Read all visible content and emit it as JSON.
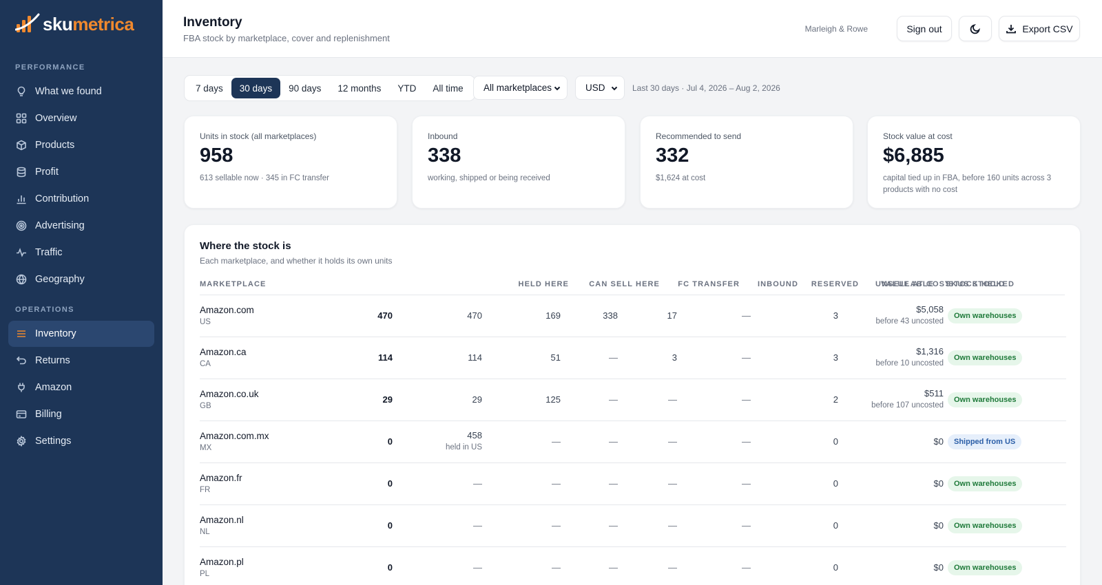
{
  "brand": {
    "part1": "sku",
    "part2": "metrica"
  },
  "sidebar": {
    "section_performance": "PERFORMANCE",
    "section_operations": "OPERATIONS",
    "items": [
      {
        "label": "What we found",
        "icon": "lightbulb-icon"
      },
      {
        "label": "Overview",
        "icon": "grid-icon"
      },
      {
        "label": "Products",
        "icon": "box-icon"
      },
      {
        "label": "Profit",
        "icon": "database-icon"
      },
      {
        "label": "Contribution",
        "icon": "bar-chart-icon"
      },
      {
        "label": "Advertising",
        "icon": "target-icon"
      },
      {
        "label": "Traffic",
        "icon": "activity-icon"
      },
      {
        "label": "Geography",
        "icon": "globe-icon"
      },
      {
        "label": "Inventory",
        "icon": "list-icon",
        "active": true
      },
      {
        "label": "Returns",
        "icon": "return-icon"
      },
      {
        "label": "Amazon",
        "icon": "plug-icon"
      },
      {
        "label": "Billing",
        "icon": "card-icon"
      },
      {
        "label": "Settings",
        "icon": "gear-icon"
      }
    ]
  },
  "header": {
    "title": "Inventory",
    "subtitle": "FBA stock by marketplace, cover and replenishment",
    "account": "Marleigh & Rowe",
    "signout": "Sign out",
    "export": "Export CSV"
  },
  "filters": {
    "ranges": [
      "7 days",
      "30 days",
      "90 days",
      "12 months",
      "YTD",
      "All time"
    ],
    "active_range": "30 days",
    "marketplace": "All marketplaces",
    "currency": "USD",
    "range_note": "Last 30 days · Jul 4, 2026 – Aug 2, 2026"
  },
  "kpis": [
    {
      "label": "Units in stock (all marketplaces)",
      "value": "958",
      "note": "613 sellable now · 345 in FC transfer"
    },
    {
      "label": "Inbound",
      "value": "338",
      "note": "working, shipped or being received"
    },
    {
      "label": "Recommended to send",
      "value": "332",
      "note": "$1,624 at cost"
    },
    {
      "label": "Stock value at cost",
      "value": "$6,885",
      "note": "capital tied up in FBA, before 160 units across 3 products with no cost"
    }
  ],
  "table": {
    "title": "Where the stock is",
    "subtitle": "Each marketplace, and whether it holds its own units",
    "columns": [
      "MARKETPLACE",
      "HELD HERE",
      "CAN SELL HERE",
      "FC TRANSFER",
      "INBOUND",
      "RESERVED",
      "UNSELLABLE",
      "SKUS STOCKED",
      "VALUE AT COST",
      "STOCK HELD"
    ],
    "rows": [
      {
        "name": "Amazon.com",
        "code": "US",
        "held": "470",
        "can_sell": "470",
        "can_sell_note": "",
        "fc": "169",
        "inbound": "338",
        "reserved": "17",
        "unsellable": "—",
        "skus": "3",
        "value": "$5,058",
        "value_note": "before 43 uncosted",
        "stock_held": "Own warehouses",
        "badge": "green"
      },
      {
        "name": "Amazon.ca",
        "code": "CA",
        "held": "114",
        "can_sell": "114",
        "can_sell_note": "",
        "fc": "51",
        "inbound": "—",
        "reserved": "3",
        "unsellable": "—",
        "skus": "3",
        "value": "$1,316",
        "value_note": "before 10 uncosted",
        "stock_held": "Own warehouses",
        "badge": "green"
      },
      {
        "name": "Amazon.co.uk",
        "code": "GB",
        "held": "29",
        "can_sell": "29",
        "can_sell_note": "",
        "fc": "125",
        "inbound": "—",
        "reserved": "—",
        "unsellable": "—",
        "skus": "2",
        "value": "$511",
        "value_note": "before 107 uncosted",
        "stock_held": "Own warehouses",
        "badge": "green"
      },
      {
        "name": "Amazon.com.mx",
        "code": "MX",
        "held": "0",
        "can_sell": "458",
        "can_sell_note": "held in US",
        "fc": "—",
        "inbound": "—",
        "reserved": "—",
        "unsellable": "—",
        "skus": "0",
        "value": "$0",
        "value_note": "",
        "stock_held": "Shipped from US",
        "badge": "blue"
      },
      {
        "name": "Amazon.fr",
        "code": "FR",
        "held": "0",
        "can_sell": "—",
        "can_sell_note": "",
        "fc": "—",
        "inbound": "—",
        "reserved": "—",
        "unsellable": "—",
        "skus": "0",
        "value": "$0",
        "value_note": "",
        "stock_held": "Own warehouses",
        "badge": "green"
      },
      {
        "name": "Amazon.nl",
        "code": "NL",
        "held": "0",
        "can_sell": "—",
        "can_sell_note": "",
        "fc": "—",
        "inbound": "—",
        "reserved": "—",
        "unsellable": "—",
        "skus": "0",
        "value": "$0",
        "value_note": "",
        "stock_held": "Own warehouses",
        "badge": "green"
      },
      {
        "name": "Amazon.pl",
        "code": "PL",
        "held": "0",
        "can_sell": "—",
        "can_sell_note": "",
        "fc": "—",
        "inbound": "—",
        "reserved": "—",
        "unsellable": "—",
        "skus": "0",
        "value": "$0",
        "value_note": "",
        "stock_held": "Own warehouses",
        "badge": "green"
      }
    ]
  },
  "colors": {
    "sidebar": "#1d3557",
    "accent": "#f0892e",
    "badge_green": "#e6f6ea",
    "badge_blue": "#e6effb"
  }
}
